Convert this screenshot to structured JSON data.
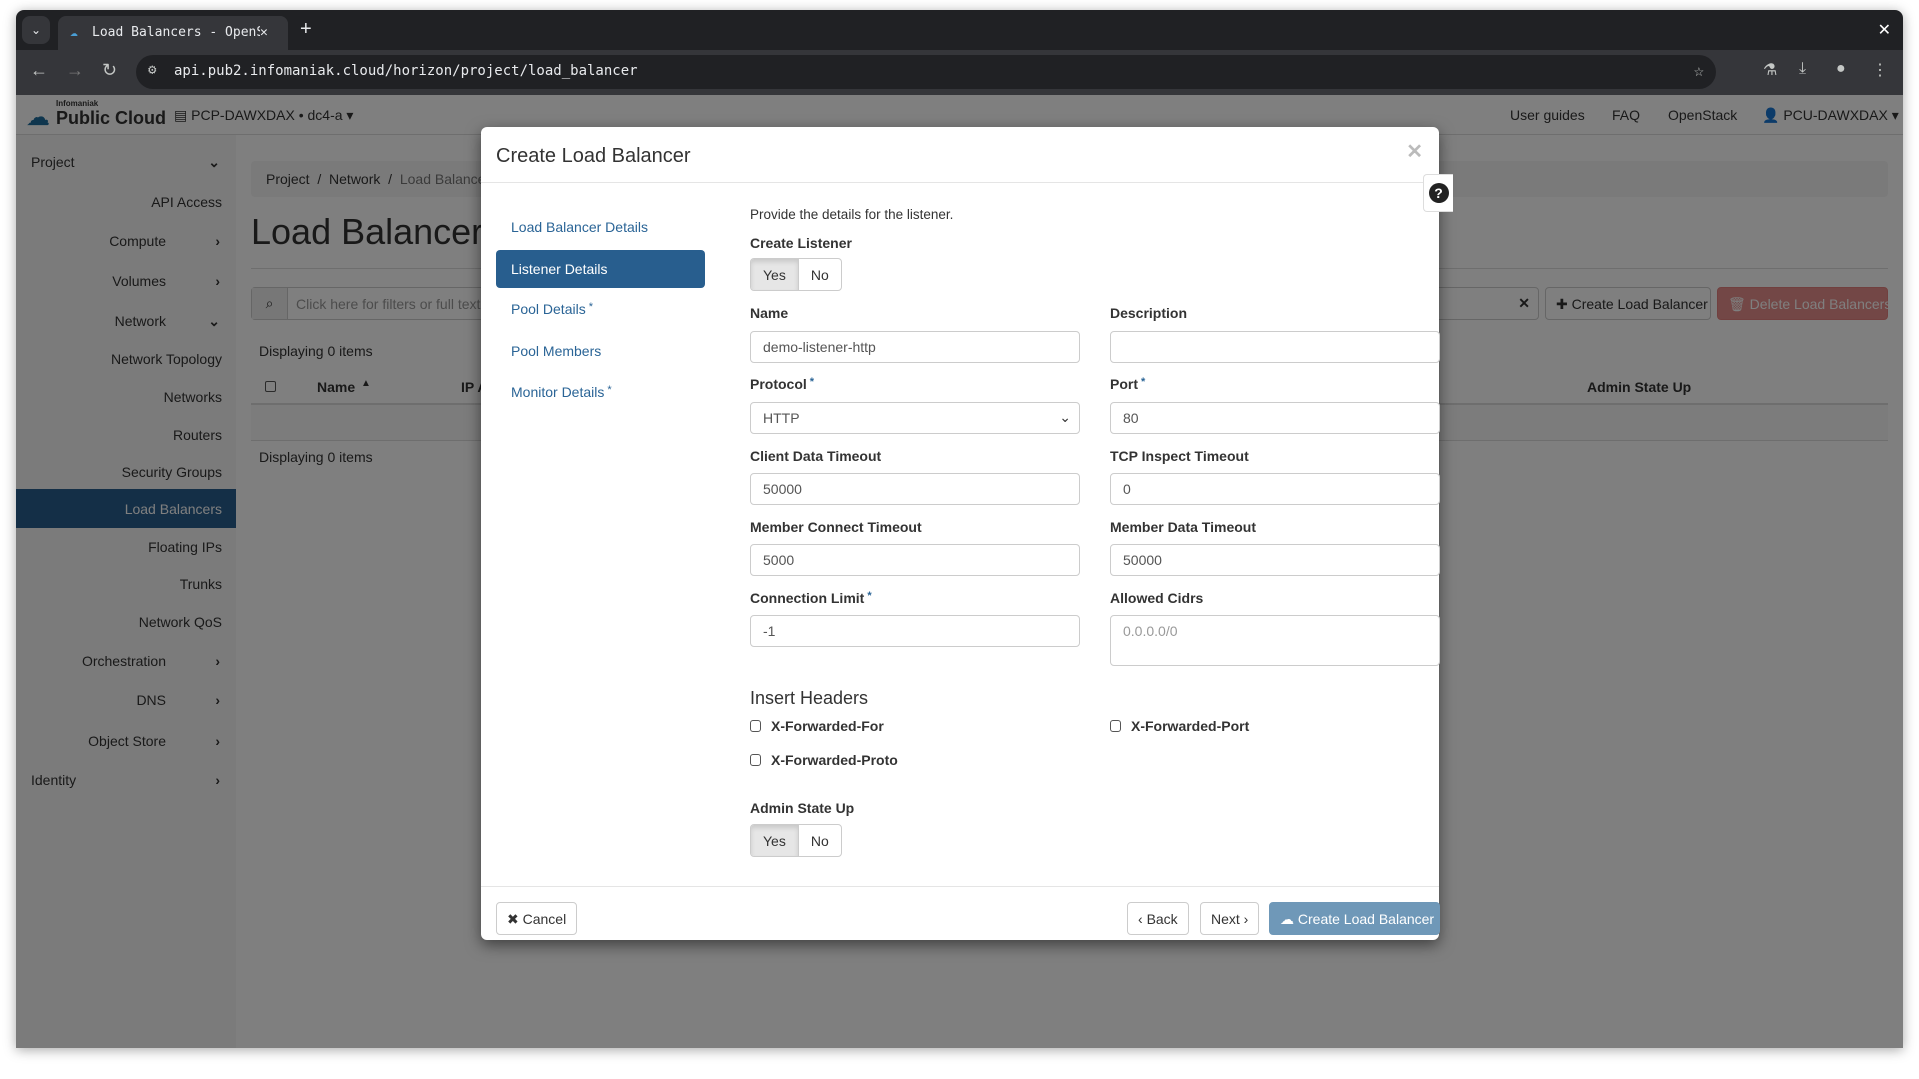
{
  "browser": {
    "tab_title": "Load Balancers - OpenStack",
    "url": "api.pub2.infomaniak.cloud/horizon/project/load_balancer"
  },
  "header": {
    "brand_small": "Infomaniak",
    "brand": "Public Cloud",
    "project": "PCP-DAWXDAX • dc4-a",
    "links": [
      "User guides",
      "FAQ",
      "OpenStack"
    ],
    "user": "PCU-DAWXDAX"
  },
  "sidebar": {
    "project": "Project",
    "api_access": "API Access",
    "compute": "Compute",
    "volumes": "Volumes",
    "network": "Network",
    "network_items": [
      "Network Topology",
      "Networks",
      "Routers",
      "Security Groups",
      "Load Balancers",
      "Floating IPs",
      "Trunks",
      "Network QoS"
    ],
    "orchestration": "Orchestration",
    "dns": "DNS",
    "object_store": "Object Store",
    "identity": "Identity"
  },
  "page": {
    "breadcrumb": [
      "Project",
      "Network",
      "Load Balancers"
    ],
    "title": "Load Balancers",
    "filter_placeholder": "Click here for filters or full text search.",
    "create_button": "Create Load Balancer",
    "delete_button": "Delete Load Balancers",
    "count_text": "Displaying 0 items",
    "columns": [
      "Name",
      "IP Address",
      "Admin State Up"
    ]
  },
  "modal": {
    "title": "Create Load Balancer",
    "steps": [
      {
        "label": "Load Balancer Details",
        "required": false
      },
      {
        "label": "Listener Details",
        "required": false,
        "active": true
      },
      {
        "label": "Pool Details",
        "required": true
      },
      {
        "label": "Pool Members",
        "required": false
      },
      {
        "label": "Monitor Details",
        "required": true
      }
    ],
    "intro": "Provide the details for the listener.",
    "create_listener": {
      "label": "Create Listener",
      "options": [
        "Yes",
        "No"
      ],
      "selected": "Yes"
    },
    "fields": {
      "name": {
        "label": "Name",
        "value": "demo-listener-http"
      },
      "description": {
        "label": "Description",
        "value": ""
      },
      "protocol": {
        "label": "Protocol",
        "value": "HTTP",
        "required": true
      },
      "port": {
        "label": "Port",
        "value": "80",
        "required": true
      },
      "client_data_timeout": {
        "label": "Client Data Timeout",
        "value": "50000"
      },
      "tcp_inspect_timeout": {
        "label": "TCP Inspect Timeout",
        "value": "0"
      },
      "member_connect_timeout": {
        "label": "Member Connect Timeout",
        "value": "5000"
      },
      "member_data_timeout": {
        "label": "Member Data Timeout",
        "value": "50000"
      },
      "connection_limit": {
        "label": "Connection Limit",
        "value": "-1",
        "required": true
      },
      "allowed_cidrs": {
        "label": "Allowed Cidrs",
        "placeholder": "0.0.0.0/0"
      }
    },
    "insert_headers": {
      "title": "Insert Headers",
      "items": [
        {
          "label": "X-Forwarded-For",
          "checked": false
        },
        {
          "label": "X-Forwarded-Port",
          "checked": false
        },
        {
          "label": "X-Forwarded-Proto",
          "checked": false
        }
      ]
    },
    "admin_state": {
      "label": "Admin State Up",
      "options": [
        "Yes",
        "No"
      ],
      "selected": "Yes"
    },
    "footer": {
      "cancel": "Cancel",
      "back": "Back",
      "next": "Next",
      "create": "Create Load Balancer"
    },
    "required_mark": "*"
  },
  "colors": {
    "accent": "#285e8e",
    "link": "#2a6496",
    "danger": "#d9534f",
    "create_disabled": "#6f98b8"
  }
}
